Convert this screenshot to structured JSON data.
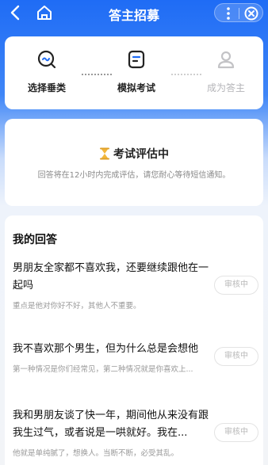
{
  "header": {
    "title": "答主招募",
    "back_icon": "chevron-left-icon",
    "home_icon": "home-icon",
    "more_icon": "more-vertical-icon",
    "close_icon": "close-circle-icon"
  },
  "steps": [
    {
      "label": "选择垂类",
      "icon": "search-chat-icon",
      "state": "done"
    },
    {
      "label": "模拟考试",
      "icon": "exam-document-icon",
      "state": "done"
    },
    {
      "label": "成为答主",
      "icon": "user-profile-icon",
      "state": "pending"
    }
  ],
  "status": {
    "icon": "hourglass-icon",
    "title": "考试评估中",
    "description": "回答将在12小时内完成评估，请您耐心等待短信通知。"
  },
  "answers": {
    "title": "我的回答",
    "items": [
      {
        "question": "男朋友全家都不喜欢我，还要继续跟他在一起吗",
        "excerpt": "重点是他对你好不好，其他人不重要。",
        "status": "审核中"
      },
      {
        "question": "我不喜欢那个男生，但为什么总是会想他",
        "excerpt": "第一种情况是你们经常见，第二种情况就是你喜欢上...",
        "status": "审核中"
      },
      {
        "question": "我和男朋友谈了快一年，期间他从来没有跟我生过气，或者说是一哄就好。我在...",
        "excerpt": "他就是单纯腻了，想换人。当断不断，必受其乱。",
        "status": "审核中"
      }
    ]
  },
  "colors": {
    "primary": "#1f6cf5",
    "muted": "#9a9a9a",
    "disabled": "#b4b4b8"
  }
}
